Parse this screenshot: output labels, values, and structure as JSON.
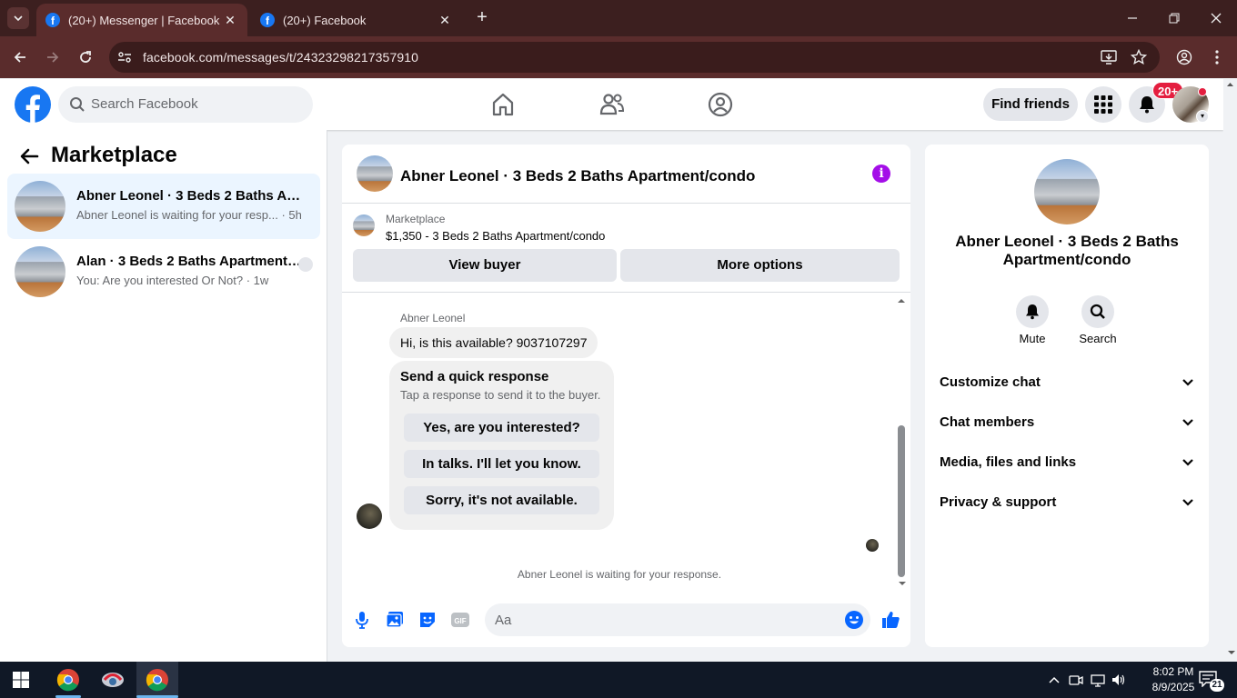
{
  "browser": {
    "tabs": [
      {
        "title": "(20+) Messenger | Facebook",
        "active": true
      },
      {
        "title": "(20+) Facebook",
        "active": false
      }
    ],
    "url": "facebook.com/messages/t/24323298217357910"
  },
  "header": {
    "search_placeholder": "Search Facebook",
    "find_friends_label": "Find friends",
    "notification_badge": "20+"
  },
  "sidebar": {
    "title": "Marketplace",
    "conversations": [
      {
        "name": "Abner Leonel · 3 Beds 2 Baths Apartment/condo",
        "snippet": "Abner Leonel is waiting for your resp...",
        "time": "· 5h",
        "selected": true
      },
      {
        "name": "Alan · 3 Beds 2 Baths Apartment/condo",
        "snippet": "You: Are you interested Or Not?",
        "time": "· 1w",
        "selected": false
      }
    ]
  },
  "chat": {
    "title": "Abner Leonel · 3 Beds 2 Baths Apartment/condo",
    "listing": {
      "label": "Marketplace",
      "item": "$1,350 - 3 Beds 2 Baths Apartment/condo",
      "view_buyer_label": "View buyer",
      "more_options_label": "More options"
    },
    "messages": [
      {
        "sender": "Abner Leonel",
        "text": "Hi, is this available? 9037107297"
      }
    ],
    "quick_response": {
      "title": "Send a quick response",
      "subtitle": "Tap a response to send it to the buyer.",
      "options": [
        "Yes, are you interested?",
        "In talks. I'll let you know.",
        "Sorry, it's not available."
      ]
    },
    "status": "Abner Leonel is waiting for your response.",
    "composer_placeholder": "Aa"
  },
  "details": {
    "name": "Abner Leonel · 3 Beds 2 Baths Apartment/condo",
    "actions": [
      {
        "label": "Mute",
        "icon": "bell-icon"
      },
      {
        "label": "Search",
        "icon": "search-icon"
      }
    ],
    "sections": [
      "Customize chat",
      "Chat members",
      "Media, files and links",
      "Privacy & support"
    ]
  },
  "taskbar": {
    "time": "8:02 PM",
    "date": "8/9/2025",
    "notifications_count": "21"
  },
  "colors": {
    "accent": "#1877f2",
    "messenger_accent": "#a40ee8",
    "selected_conversation": "#ebf5ff",
    "badge": "#e41e3f"
  }
}
